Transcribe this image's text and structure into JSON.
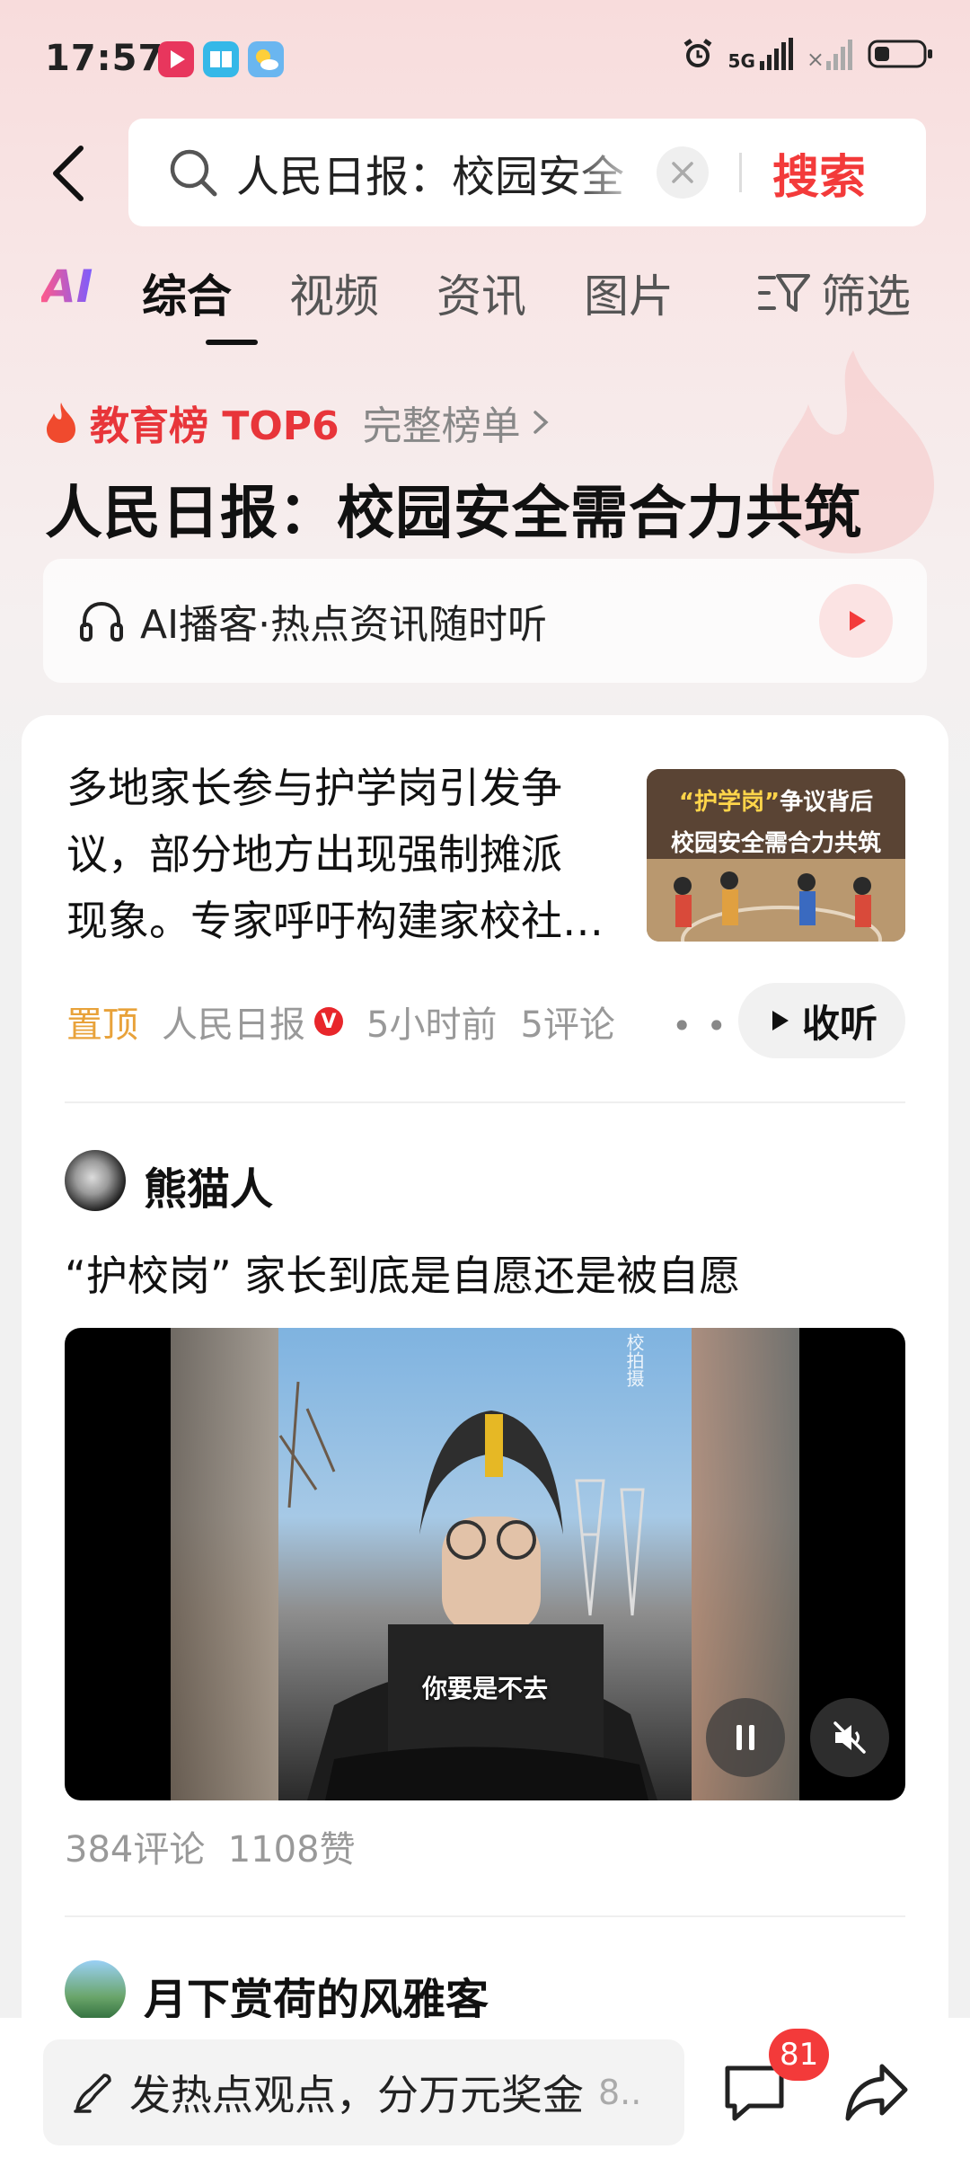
{
  "status_bar": {
    "time": "17:57",
    "network": "5G",
    "signal_x": "×"
  },
  "search": {
    "query": "人民日报：校园安全",
    "button": "搜索"
  },
  "tabs": [
    {
      "label": "AI"
    },
    {
      "label": "综合"
    },
    {
      "label": "视频"
    },
    {
      "label": "资讯"
    },
    {
      "label": "图片"
    }
  ],
  "filter": {
    "label": "筛选"
  },
  "hot": {
    "title": "教育榜 TOP6",
    "full_list": "完整榜单",
    "headline": "人民日报：校园安全需合力共筑"
  },
  "podcast": {
    "text": "AI播客·热点资讯随时听"
  },
  "article": {
    "lines": [
      "多地家长参与护学岗引发争",
      "议，部分地方出现强制摊派",
      "现象。专家呼吁构建家校社…"
    ],
    "thumb_tag_quote": "“护学岗”",
    "thumb_tag_rest": "争议背后",
    "thumb_sub": "校园安全需合力共筑",
    "pin": "置顶",
    "source": "人民日报",
    "verified": "V",
    "time": "5小时前",
    "comments": "5评论",
    "listen": "收听"
  },
  "post": {
    "author": "熊猫人",
    "title": "“护校岗” 家长到底是自愿还是被自愿",
    "subtitle": "你要是不去",
    "watermark": "校拍摄",
    "stats": "384评论  1108赞"
  },
  "post2": {
    "author": "月下赏荷的风雅客"
  },
  "bottom": {
    "input": "发热点观点，分万元奖金",
    "input_more": "8..",
    "badge": "81"
  },
  "colors": {
    "accent": "#f33a3a",
    "hot": "#e8353a",
    "pin": "#e8a23a"
  }
}
